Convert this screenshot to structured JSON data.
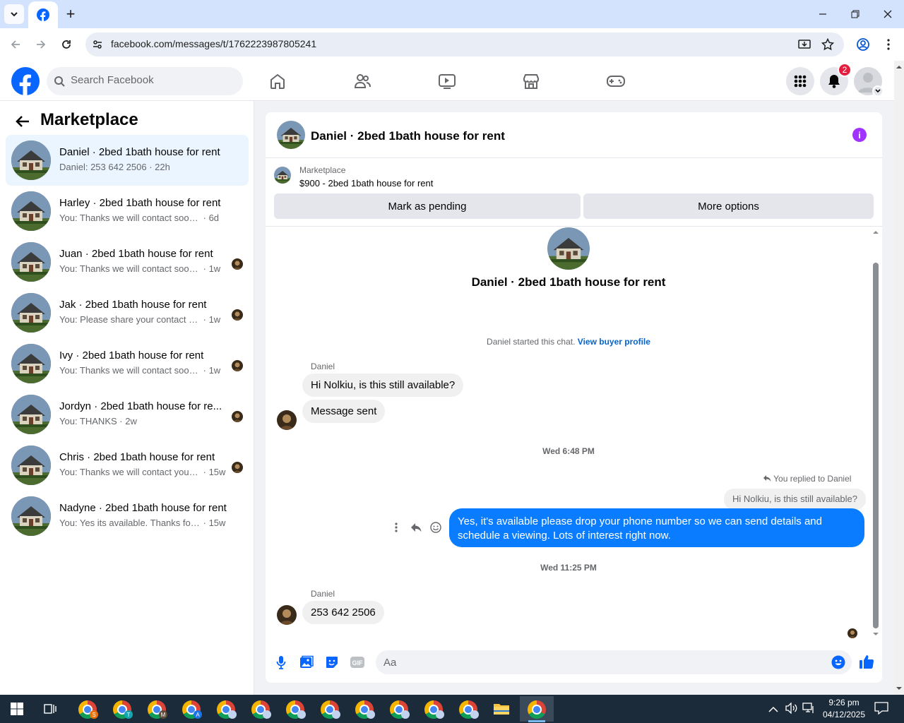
{
  "browser": {
    "url": "facebook.com/messages/t/1762223987805241"
  },
  "header": {
    "search_placeholder": "Search Facebook",
    "notifications_count": "2"
  },
  "sidebar": {
    "title": "Marketplace",
    "conversations": [
      {
        "name": "Daniel · 2bed 1bath house for rent",
        "preview": "Daniel: 253 642 2506",
        "time": "22h",
        "active": true
      },
      {
        "name": "Harley · 2bed 1bath house for rent",
        "preview": "You: Thanks we will contact soon with...",
        "time": "6d"
      },
      {
        "name": "Juan · 2bed 1bath house for rent",
        "preview": "You: Thanks we will contact soon ...",
        "time": "1w"
      },
      {
        "name": "Jak · 2bed 1bath house for rent",
        "preview": "You: Please share your contact nu...",
        "time": "1w"
      },
      {
        "name": "Ivy · 2bed 1bath house for rent",
        "preview": "You: Thanks we will contact soon ...",
        "time": "1w"
      },
      {
        "name": "Jordyn · 2bed 1bath house for re...",
        "preview": "You: THANKS",
        "time": "2w"
      },
      {
        "name": "Chris · 2bed 1bath house for rent",
        "preview": "You: Thanks we will contact you s...",
        "time": "15w"
      },
      {
        "name": "Nadyne · 2bed 1bath house for rent",
        "preview": "You: Yes its available. Thanks for reac...",
        "time": "15w"
      }
    ]
  },
  "chat": {
    "title": "Daniel · 2bed 1bath house for rent",
    "marketplace_label": "Marketplace",
    "listing": "$900 - 2bed 1bath house for rent",
    "mark_pending": "Mark as pending",
    "more_options": "More options",
    "intro_title": "Daniel · 2bed 1bath house for rent",
    "started_text": "Daniel started this chat.",
    "view_profile": "View buyer profile",
    "sender1": "Daniel",
    "msg1": "Hi Nolkiu, is this still available?",
    "msg2": "Message sent",
    "ts1": "Wed 6:48 PM",
    "replied_text": "You replied to Daniel",
    "quoted": "Hi Nolkiu, is this still available?",
    "my_msg": "Yes, it's available please drop your phone number so we can send details and schedule a viewing. Lots of interest right now.",
    "ts2": "Wed 11:25 PM",
    "sender2": "Daniel",
    "msg3": "253 642 2506",
    "composer_placeholder": "Aa"
  },
  "taskbar": {
    "time": "9:26 pm",
    "date": "04/12/2025",
    "profile_letters": [
      "S",
      "T",
      "M",
      "A"
    ]
  }
}
